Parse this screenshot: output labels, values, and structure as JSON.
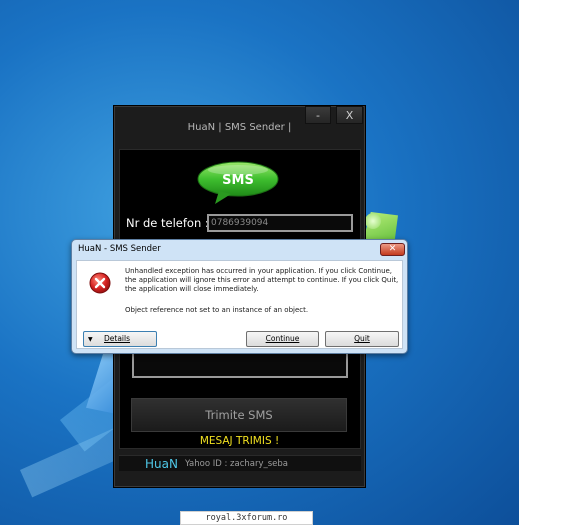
{
  "app": {
    "title": "HuaN | SMS Sender |",
    "minimize_label": "-",
    "close_label": "X",
    "logo_text": "SMS",
    "phone_label": "Nr de telefon :",
    "phone_value": "0786939094",
    "send_label": "Trimite SMS",
    "status_text": "MESAJ TRIMIS !",
    "footer_brand": "HuaN",
    "footer_yahoo": "Yahoo ID : zachary_seba"
  },
  "dialog": {
    "title": "HuaN - SMS Sender",
    "close_label": "✕",
    "message": "Unhandled exception has occurred in your application. If you click Continue, the application will ignore this error and attempt to continue. If you click Quit, the application will close immediately.",
    "detail": "Object reference not set to an instance of an object.",
    "details_label": "Details",
    "continue_label": "Continue",
    "quit_label": "Quit",
    "icon": "error-icon"
  },
  "watermark": "royal.3xforum.ro",
  "colors": {
    "accent_green": "#3fbf2f",
    "status_yellow": "#f0e020",
    "brand_cyan": "#4fc8e8",
    "error_red": "#d42020"
  }
}
